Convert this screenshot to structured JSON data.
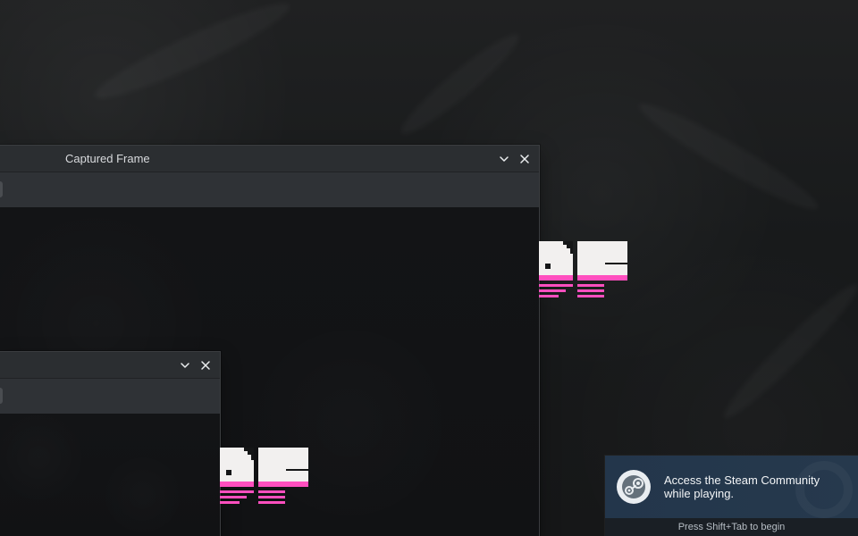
{
  "windows": {
    "main": {
      "title": "Captured Frame"
    },
    "small": {
      "title": ""
    }
  },
  "icons": {
    "collapse": "chevron-down-icon",
    "close": "close-icon",
    "steam": "steam-icon"
  },
  "overlay": {
    "message": "Access the Steam Community while playing.",
    "hint": "Press Shift+Tab to begin"
  },
  "colors": {
    "logo_light": "#f2f0ef",
    "logo_pink": "#ff4fbf",
    "toast_bg": "#24364a"
  }
}
